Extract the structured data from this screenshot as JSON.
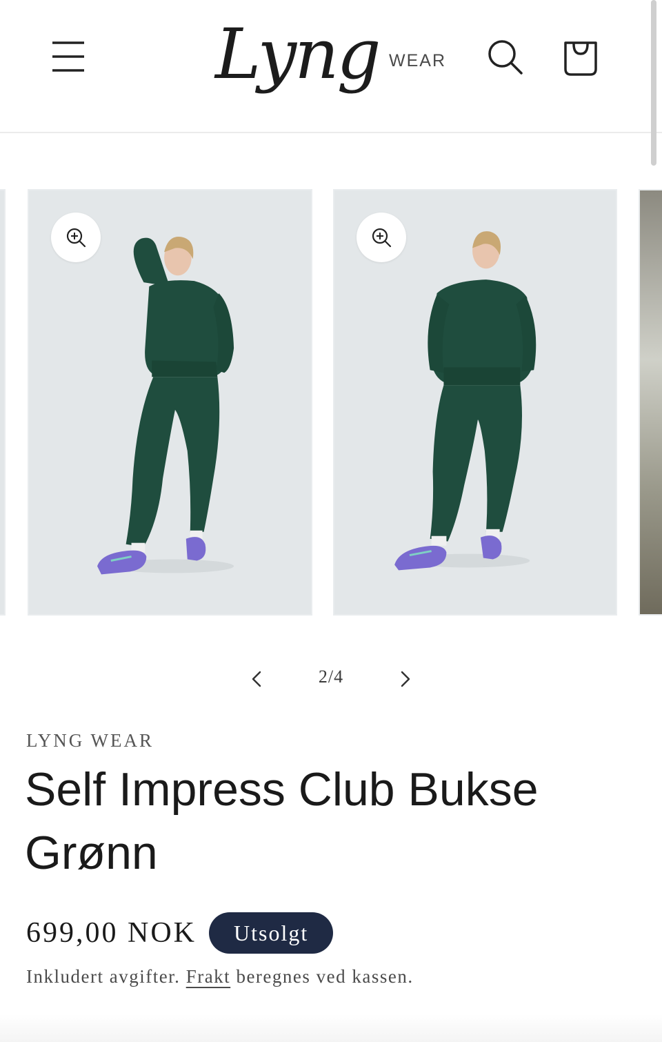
{
  "header": {
    "logo_script": "Lyng",
    "logo_suffix": "WEAR",
    "menu_icon": "hamburger-menu-icon",
    "search_icon": "search-icon",
    "cart_icon": "cart-icon"
  },
  "gallery": {
    "counter": "2/4",
    "zoom_icon": "zoom-in-icon",
    "prev_icon": "chevron-left-icon",
    "next_icon": "chevron-right-icon"
  },
  "product": {
    "vendor": "LYNG WEAR",
    "title": "Self Impress Club Bukse Grønn",
    "price": "699,00 NOK",
    "badge": "Utsolgt",
    "tax_before": "Inkludert avgifter. ",
    "tax_link": "Frakt",
    "tax_after": " beregnes ved kassen."
  },
  "colors": {
    "badge_bg": "#1f2a44",
    "outfit_green": "#1f4d3e",
    "shoe_purple": "#7a6bd0"
  }
}
